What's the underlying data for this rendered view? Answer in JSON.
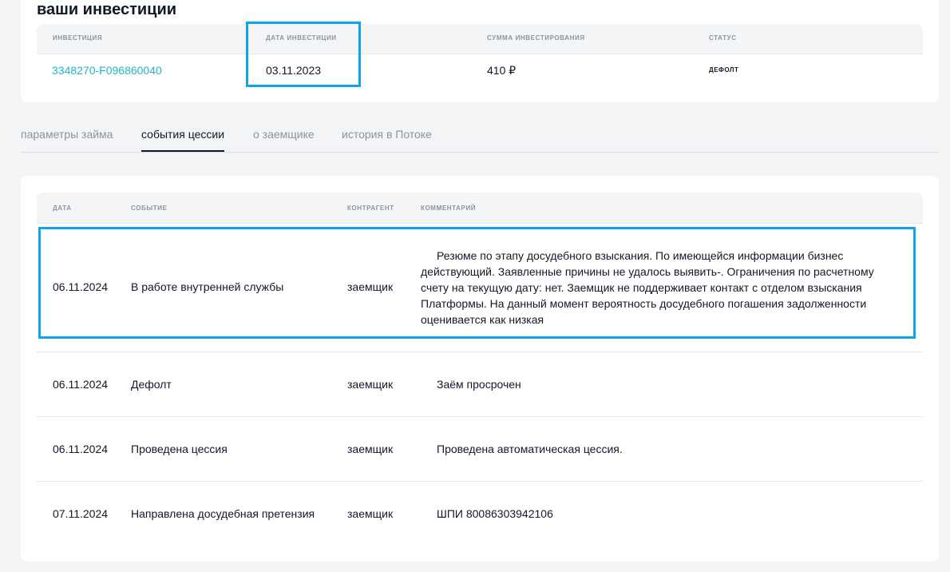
{
  "investments": {
    "title": "ваши инвестиции",
    "headers": {
      "investment": "ИНВЕСТИЦИЯ",
      "date": "ДАТА ИНВЕСТИЦИИ",
      "sum": "СУММА ИНВЕСТИРОВАНИЯ",
      "status": "СТАТУС"
    },
    "row": {
      "investment": "3348270-F096860040",
      "date": "03.11.2023",
      "sum": "410 ₽",
      "status": "ДЕФОЛТ"
    }
  },
  "tabs": [
    {
      "label": "параметры займа"
    },
    {
      "label": "события цессии"
    },
    {
      "label": "о заемщике"
    },
    {
      "label": "история в Потоке"
    }
  ],
  "events": {
    "headers": {
      "date": "ДАТА",
      "event": "СОБЫТИЕ",
      "counterparty": "КОНТРАГЕНТ",
      "comment": "КОММЕНТАРИЙ"
    },
    "rows": [
      {
        "date": "06.11.2024",
        "event": "В работе внутренней службы",
        "counterparty": "заемщик",
        "comment": "Резюме по этапу досудебного взыскания. По имеющейся информации бизнес действующий. Заявленные причины не удалось выявить-. Ограничения по расчетному счету на текущую дату: нет. Заемщик не  поддерживает контакт с отделом взыскания Платформы. На данный момент вероятность досудебного погашения задолженности оценивается как низкая"
      },
      {
        "date": "06.11.2024",
        "event": "Дефолт",
        "counterparty": "заемщик",
        "comment": "Заём просрочен"
      },
      {
        "date": "06.11.2024",
        "event": "Проведена цессия",
        "counterparty": "заемщик",
        "comment": "Проведена автоматическая цессия."
      },
      {
        "date": "07.11.2024",
        "event": "Направлена досудебная претензия",
        "counterparty": "заемщик",
        "comment": "ШПИ 80086303942106"
      }
    ]
  },
  "colors": {
    "accent_link": "#1fb4c6",
    "highlight_border": "#0ea5e9",
    "muted_text": "#8a93a0"
  }
}
